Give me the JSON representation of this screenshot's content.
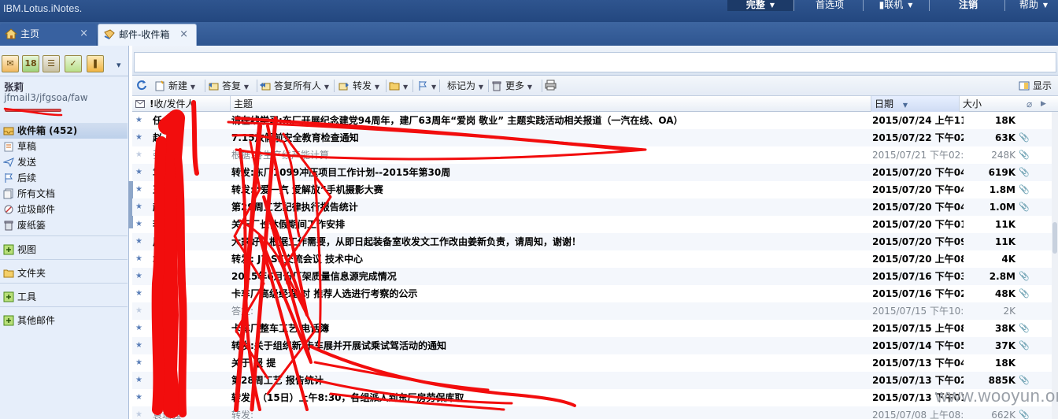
{
  "app": {
    "brand": "IBM.Lotus.iNotes."
  },
  "topnav": {
    "full": "完整",
    "prefs": "首选项",
    "online": "联机",
    "logout": "注销",
    "help": "帮助"
  },
  "tabs": {
    "home": "主页",
    "inbox": "邮件-收件箱",
    "close": "×"
  },
  "user": {
    "name": "张莉",
    "path": "jfmail3/jfgsoa/faw"
  },
  "folders": {
    "inbox": "收件箱 (452)",
    "drafts": "草稿",
    "sent": "发送",
    "followup": "后续",
    "all": "所有文档",
    "junk": "垃圾邮件",
    "trash": "废纸篓",
    "views": "视图",
    "folder": "文件夹",
    "tools": "工具",
    "other": "其他邮件"
  },
  "actions": {
    "new": "新建",
    "reply": "答复",
    "reply_all": "答复所有人",
    "forward": "转发",
    "mark": "标记为",
    "more": "更多",
    "show": "显示"
  },
  "columns": {
    "from": "收/发件人",
    "subject": "主题",
    "date": "日期",
    "size": "大小"
  },
  "rows": [
    {
      "sender": "任 艳",
      "subject": "请在线学习:东厂开展纪念建党94周年，建厂63周年“爱岗 敬业” 主题实践活动相关报道（一汽在线、OA）",
      "date": "2015/07/24 上午11:5",
      "size": "18K",
      "clip": ""
    },
    {
      "sender": "赵 英",
      "subject": "7.15放假前安全教育检查通知",
      "date": "2015/07/22 下午02:0",
      "size": "63K",
      "clip": "📎"
    },
    {
      "sender": "张 强",
      "subject": "根据:各生产线产能计算",
      "date": "2015/07/21 下午02:5",
      "size": "248K",
      "clip": "📎"
    },
    {
      "sender": "袁 强",
      "subject": "转发:东厂1099冲压项目工作计划--2015年第30周",
      "date": "2015/07/20 下午04:5",
      "size": "619K",
      "clip": "📎"
    },
    {
      "sender": "王 军",
      "subject": "转发:“爱一汽 爱解放”手机摄影大赛",
      "date": "2015/07/20 下午04:4",
      "size": "1.8M",
      "clip": "📎"
    },
    {
      "sender": "赵 英",
      "subject": "第29周工艺纪律执行报告统计",
      "date": "2015/07/20 下午04:2",
      "size": "1.0M",
      "clip": "📎"
    },
    {
      "sender": "李 旺",
      "subject": "关于厂长休假期间工作安排",
      "date": "2015/07/20 下午01:5",
      "size": "11K",
      "clip": ""
    },
    {
      "sender": "周 海",
      "subject": "大家好，根据工作需要，从即日起装备室收发文工作改由姜新负责，请周知，谢谢！",
      "date": "2015/07/20 下午09:4",
      "size": "11K",
      "clip": ""
    },
    {
      "sender": "袁 强",
      "subject": "转发: J7 SE交流会议 技术中心",
      "date": "2015/07/20 上午08:0",
      "size": "4K",
      "clip": ""
    },
    {
      "sender": "周 海",
      "subject": "2015年6月份厂架质量信息源完成情况",
      "date": "2015/07/16 下午03:2",
      "size": "2.8M",
      "clip": "📎"
    },
    {
      "sender": "王 岩",
      "subject": "卡车厂高级经理 对 推荐人选进行考察的公示",
      "date": "2015/07/16 下午02:4",
      "size": "48K",
      "clip": "📎"
    },
    {
      "sender": "",
      "subject": "答复:",
      "date": "2015/07/15 下午10:2",
      "size": "2K",
      "clip": ""
    },
    {
      "sender": "",
      "subject": "卡车厂整车工艺 电话簿",
      "date": "2015/07/15 上午08:1",
      "size": "38K",
      "clip": "📎"
    },
    {
      "sender": "",
      "subject": "转发:关于组织新 卡车展并开展试乘试驾活动的通知",
      "date": "2015/07/14 下午05:0",
      "size": "37K",
      "clip": "📎"
    },
    {
      "sender": "",
      "subject": "关于    报 提",
      "date": "2015/07/13 下午04:1",
      "size": "18K",
      "clip": ""
    },
    {
      "sender": "",
      "subject": "第28周工艺   报告统计",
      "date": "2015/07/13 下午02:2",
      "size": "885K",
      "clip": "📎"
    },
    {
      "sender": "袁 强",
      "subject": "转发:   （15日）上午8:30，各组派人到东厂房劳保库取",
      "date": "2015/07/13 下午01:3",
      "size": "",
      "clip": ""
    },
    {
      "sender": "袁瑞强",
      "subject": "转发:",
      "date": "2015/07/08 上午08:5",
      "size": "662K",
      "clip": "📎"
    }
  ],
  "watermark": "www.wooyun.org",
  "colors": {
    "accent": "#2f558f",
    "scribble": "#f20d0d"
  }
}
